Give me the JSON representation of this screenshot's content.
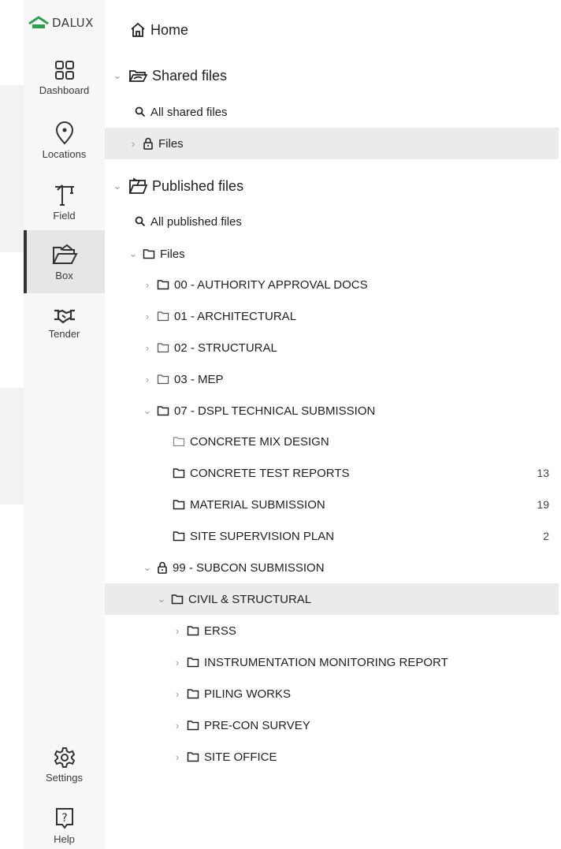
{
  "brand": {
    "logo_text": "DALUX"
  },
  "nav": {
    "dashboard": "Dashboard",
    "locations": "Locations",
    "field": "Field",
    "box": "Box",
    "tender": "Tender",
    "settings": "Settings",
    "help": "Help"
  },
  "tree": {
    "home": "Home",
    "shared": {
      "label": "Shared files",
      "all": "All shared files",
      "files": "Files"
    },
    "published": {
      "label": "Published files",
      "all": "All published files",
      "files": "Files",
      "folders": [
        {
          "label": "00 - AUTHORITY APPROVAL DOCS"
        },
        {
          "label": "01 - ARCHITECTURAL"
        },
        {
          "label": "02 - STRUCTURAL"
        },
        {
          "label": "03 - MEP"
        },
        {
          "label": "07 - DSPL TECHNICAL SUBMISSION"
        }
      ],
      "dspl_children": [
        {
          "label": "CONCRETE MIX DESIGN",
          "count": ""
        },
        {
          "label": "CONCRETE TEST REPORTS",
          "count": "13"
        },
        {
          "label": "MATERIAL SUBMISSION",
          "count": "19"
        },
        {
          "label": "SITE SUPERVISION PLAN",
          "count": "2"
        }
      ],
      "subcon": "99 - SUBCON SUBMISSION",
      "civil": "CIVIL & STRUCTURAL",
      "civil_children": [
        {
          "label": "ERSS"
        },
        {
          "label": "INSTRUMENTATION MONITORING REPORT"
        },
        {
          "label": "PILING WORKS"
        },
        {
          "label": "PRE-CON SURVEY"
        },
        {
          "label": "SITE OFFICE"
        }
      ]
    }
  },
  "colors": {
    "accent": "#2e9e4f",
    "rail_bg": "#f7f7f7",
    "highlight": "#ebebeb"
  }
}
